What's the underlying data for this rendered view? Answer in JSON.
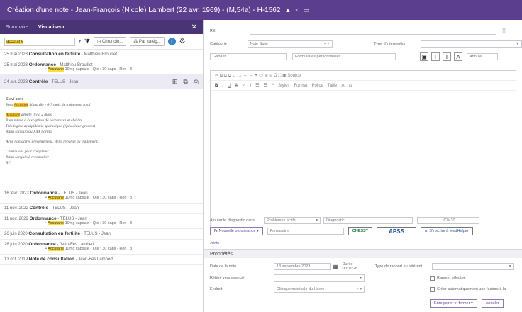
{
  "title": "Création d'une note - Jean-François (Nicole) Lambert (22 avr. 1969) - (M,54a) - H-1562",
  "left": {
    "tabs": [
      "Sommaire",
      "Visualiseur"
    ],
    "search_value": "accutane",
    "filters": [
      "Chronolo...",
      "Par catég..."
    ],
    "entries": [
      {
        "date": "25 mai 2023",
        "kind": "Consultation en fertilité",
        "who": "- Matthieu Brouillet",
        "detail": ""
      },
      {
        "date": "25 mai 2023",
        "kind": "Ordonnance",
        "who": "- Matthieu Brouillet",
        "detail": "Accutane 10mg capsule - Qte : 30 caps - Ren : 3"
      },
      {
        "date": "24 avr. 2023",
        "kind": "Contrôle",
        "who": "- TELUS - Jean",
        "detail": ""
      },
      {
        "date": "16 févr. 2023",
        "kind": "Ordonnance",
        "who": "- TELUS - Jean",
        "detail": "Accutane 10mg capsule - Qte : 30 caps - Ren : 3"
      },
      {
        "date": "11 nov. 2022",
        "kind": "Contrôle",
        "who": "- TELUS - Jean",
        "detail": ""
      },
      {
        "date": "11 nov. 2022",
        "kind": "Ordonnance",
        "who": "- TELUS - Jean",
        "detail": "Accutane 10mg capsule - Qte : 30 caps - Ren : 3"
      },
      {
        "date": "26 juin 2020",
        "kind": "Consultation en fertilité",
        "who": "- TELUS - Jean",
        "detail": ""
      },
      {
        "date": "26 juin 2020",
        "kind": "Ordonnance",
        "who": "- Jean-Fes Lambert",
        "detail": "Accutane 10mg capsule - Qte : 30 caps - Ren : 3"
      },
      {
        "date": "13 oct. 2019",
        "kind": "Note de consultation",
        "who": "- Jean-Fes Lambert",
        "detail": ""
      }
    ],
    "note": {
      "heading": "Suivi acné",
      "line1_a": "Sous ",
      "line1_hl": "Accutane",
      "line1_b": " 40mg die - 6-7 mois de traitement total",
      "line2_hl": "Accutane",
      "line2_b": " débuté il y a 2 mois",
      "line3": "Rien relevé à l'exception de sécheresse et chéilite",
      "line4": "Très légère dyslipidémie sporadique (épisodique grosses)",
      "line5": "Bilan sanguin du XXX normal",
      "line6": "Acné non active présentement. Belle réponse au traitement.",
      "line7": "Continuons pour compléter",
      "line8": "Bilan sanguin à reconsulter",
      "line9": "RV"
    }
  },
  "right": {
    "re_label": "RE",
    "categorie_label": "Catégorie",
    "categorie_value": "Note Suivi",
    "type_label": "Type d'intervention",
    "gabarit_placeholder": "Gabarit",
    "formulaire_placeholder": "Formulaires personnalisés",
    "annuler_label": "Annulé",
    "toolbar_row1": "✂  ⧉  ⧉  ⧉  ←  →  ⇔  ⇔  ⚑  ▭  ⊞  ⊟  Ω  ⛶  ▣ Source",
    "toolbar_row2_items": [
      "B",
      "I",
      "U",
      "S",
      "✓",
      "I̲",
      "☰",
      "☰",
      "❝",
      "Styles",
      "Format",
      "Police",
      "Taille",
      "A",
      "⊡"
    ],
    "diag_label": "Ajouter le diagnostic dans",
    "diag_value": "Problèmes actifs",
    "diag_placeholder": "Diagnostic",
    "cim_label": "CIM10",
    "nouvelle_ordonnance": "Nouvelle ordonnance",
    "formulaire_btn": "Formulaire",
    "cnesst": "CNESST",
    "apss": "APSS",
    "medrelay": "S'inscrire à MedHelper",
    "joints": "Joints",
    "proprietes": "Propriétés",
    "date_label": "Date de la note",
    "date_value": "18 septembre 2023",
    "duree_label": "Durée",
    "duree_value": "00:01:28",
    "rapport_label": "Type de rapport au référent",
    "rapport_effectue": "Rapport effectué",
    "orient_label": "Référé vers associé",
    "factur_label": "Créer automatiquement une facture à la",
    "endroit_label": "Endroit",
    "endroit_value": "Clinique médicale du Havre",
    "save_btn": "Enregistrer et fermer",
    "cancel_btn": "Annuler"
  }
}
